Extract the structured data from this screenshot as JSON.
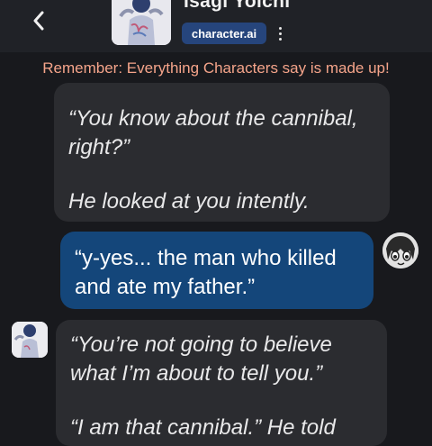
{
  "header": {
    "back_icon": "chevron-left-icon",
    "character_name": "Isagi Yoichi",
    "badge_label": "character.ai",
    "menu_icon": "more-vertical-icon"
  },
  "warning": "Remember: Everything Characters say is made up!",
  "messages": [
    {
      "sender": "character",
      "lines": [
        "“You know about the cannibal, right?”",
        "He looked at you intently."
      ]
    },
    {
      "sender": "user",
      "lines": [
        "“y-yes... the man who killed and ate my father.”"
      ]
    },
    {
      "sender": "character",
      "lines": [
        "“You’re not going to believe what I’m about to tell you.”",
        "“I am that cannibal.” He told"
      ]
    }
  ],
  "colors": {
    "background": "#18191d",
    "header": "#202227",
    "character_bubble": "#2b2c30",
    "user_bubble": "#14467a",
    "badge": "#26457c",
    "warning_text": "#f5a48a"
  }
}
